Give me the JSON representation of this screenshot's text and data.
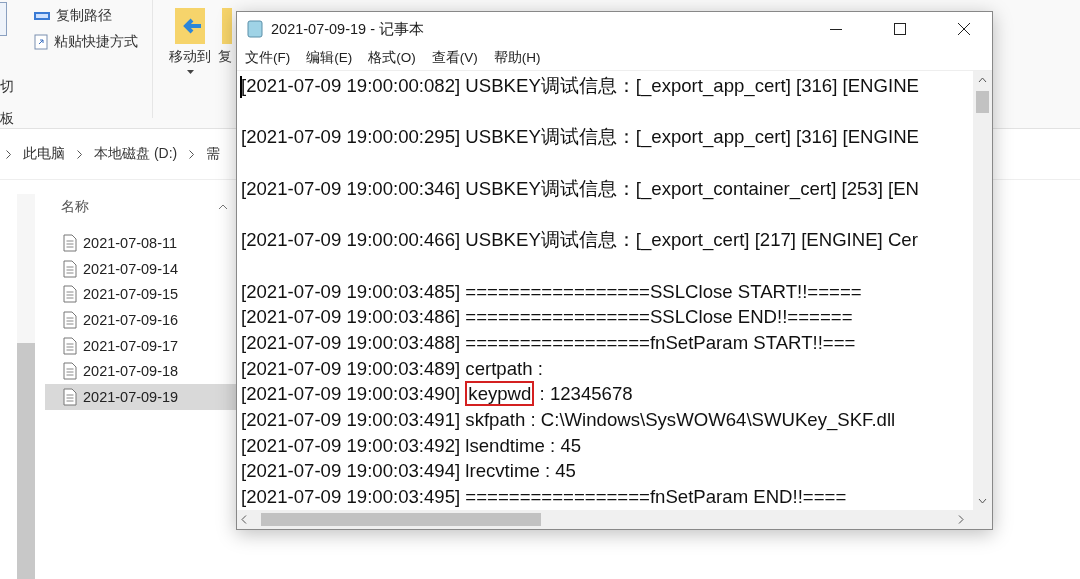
{
  "explorer": {
    "ribbon": {
      "clipboard_labels": [
        "切",
        "板"
      ],
      "small_actions": [
        {
          "label": "复制路径"
        },
        {
          "label": "粘贴快捷方式"
        }
      ],
      "big_actions": [
        {
          "label": "移动到",
          "menu": true
        },
        {
          "label": "复",
          "menu": false
        }
      ]
    },
    "breadcrumb": [
      "此电脑",
      "本地磁盘 (D:)",
      "需"
    ],
    "column_header": "名称",
    "files": [
      {
        "name": "2021-07-08-11",
        "selected": false
      },
      {
        "name": "2021-07-09-14",
        "selected": false
      },
      {
        "name": "2021-07-09-15",
        "selected": false
      },
      {
        "name": "2021-07-09-16",
        "selected": false
      },
      {
        "name": "2021-07-09-17",
        "selected": false
      },
      {
        "name": "2021-07-09-18",
        "selected": false
      },
      {
        "name": "2021-07-09-19",
        "selected": true
      }
    ]
  },
  "notepad": {
    "title": "2021-07-09-19 - 记事本",
    "menu": [
      "文件(F)",
      "编辑(E)",
      "格式(O)",
      "查看(V)",
      "帮助(H)"
    ],
    "lines": [
      {
        "kind": "plain",
        "text": "[2021-07-09 19:00:00:082] USBKEY调试信息：[_export_app_cert] [316] [ENGINE"
      },
      {
        "kind": "blank"
      },
      {
        "kind": "plain",
        "text": "[2021-07-09 19:00:00:295] USBKEY调试信息：[_export_app_cert] [316] [ENGINE"
      },
      {
        "kind": "blank"
      },
      {
        "kind": "plain",
        "text": "[2021-07-09 19:00:00:346] USBKEY调试信息：[_export_container_cert] [253] [EN"
      },
      {
        "kind": "blank"
      },
      {
        "kind": "plain",
        "text": "[2021-07-09 19:00:00:466] USBKEY调试信息：[_export_cert] [217] [ENGINE] Cer"
      },
      {
        "kind": "blank"
      },
      {
        "kind": "plain",
        "text": "[2021-07-09 19:00:03:485] =================SSLClose START!!====="
      },
      {
        "kind": "plain",
        "text": "[2021-07-09 19:00:03:486] =================SSLClose END!!======"
      },
      {
        "kind": "plain",
        "text": "[2021-07-09 19:00:03:488] =================fnSetParam START!!==="
      },
      {
        "kind": "plain",
        "text": "[2021-07-09 19:00:03:489] certpath :"
      },
      {
        "kind": "marked",
        "before": "[2021-07-09 19:00:03:490] ",
        "marked": "keypwd",
        "after": " : 12345678"
      },
      {
        "kind": "plain",
        "text": "[2021-07-09 19:00:03:491] skfpath : C:\\Windows\\SysWOW64\\SWUKey_SKF.dll"
      },
      {
        "kind": "plain",
        "text": "[2021-07-09 19:00:03:492] lsendtime : 45"
      },
      {
        "kind": "plain",
        "text": "[2021-07-09 19:00:03:494] lrecvtime : 45"
      },
      {
        "kind": "plain",
        "text": "[2021-07-09 19:00:03:495] =================fnSetParam END!!===="
      }
    ]
  }
}
